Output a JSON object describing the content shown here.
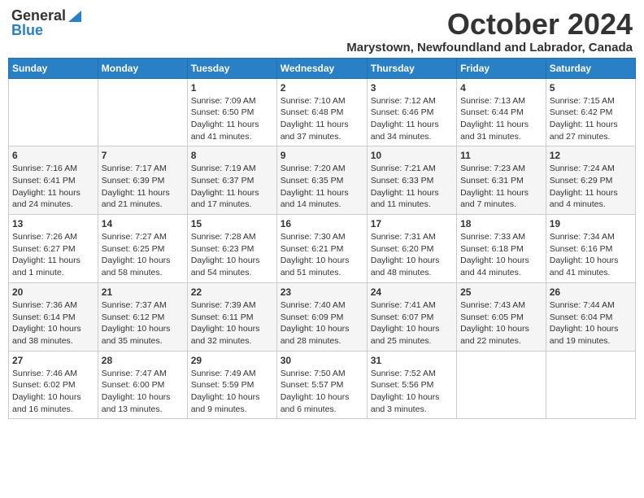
{
  "logo": {
    "general": "General",
    "blue": "Blue"
  },
  "title": "October 2024",
  "location": "Marystown, Newfoundland and Labrador, Canada",
  "days_of_week": [
    "Sunday",
    "Monday",
    "Tuesday",
    "Wednesday",
    "Thursday",
    "Friday",
    "Saturday"
  ],
  "weeks": [
    [
      {
        "day": "",
        "sunrise": "",
        "sunset": "",
        "daylight": ""
      },
      {
        "day": "",
        "sunrise": "",
        "sunset": "",
        "daylight": ""
      },
      {
        "day": "1",
        "sunrise": "Sunrise: 7:09 AM",
        "sunset": "Sunset: 6:50 PM",
        "daylight": "Daylight: 11 hours and 41 minutes."
      },
      {
        "day": "2",
        "sunrise": "Sunrise: 7:10 AM",
        "sunset": "Sunset: 6:48 PM",
        "daylight": "Daylight: 11 hours and 37 minutes."
      },
      {
        "day": "3",
        "sunrise": "Sunrise: 7:12 AM",
        "sunset": "Sunset: 6:46 PM",
        "daylight": "Daylight: 11 hours and 34 minutes."
      },
      {
        "day": "4",
        "sunrise": "Sunrise: 7:13 AM",
        "sunset": "Sunset: 6:44 PM",
        "daylight": "Daylight: 11 hours and 31 minutes."
      },
      {
        "day": "5",
        "sunrise": "Sunrise: 7:15 AM",
        "sunset": "Sunset: 6:42 PM",
        "daylight": "Daylight: 11 hours and 27 minutes."
      }
    ],
    [
      {
        "day": "6",
        "sunrise": "Sunrise: 7:16 AM",
        "sunset": "Sunset: 6:41 PM",
        "daylight": "Daylight: 11 hours and 24 minutes."
      },
      {
        "day": "7",
        "sunrise": "Sunrise: 7:17 AM",
        "sunset": "Sunset: 6:39 PM",
        "daylight": "Daylight: 11 hours and 21 minutes."
      },
      {
        "day": "8",
        "sunrise": "Sunrise: 7:19 AM",
        "sunset": "Sunset: 6:37 PM",
        "daylight": "Daylight: 11 hours and 17 minutes."
      },
      {
        "day": "9",
        "sunrise": "Sunrise: 7:20 AM",
        "sunset": "Sunset: 6:35 PM",
        "daylight": "Daylight: 11 hours and 14 minutes."
      },
      {
        "day": "10",
        "sunrise": "Sunrise: 7:21 AM",
        "sunset": "Sunset: 6:33 PM",
        "daylight": "Daylight: 11 hours and 11 minutes."
      },
      {
        "day": "11",
        "sunrise": "Sunrise: 7:23 AM",
        "sunset": "Sunset: 6:31 PM",
        "daylight": "Daylight: 11 hours and 7 minutes."
      },
      {
        "day": "12",
        "sunrise": "Sunrise: 7:24 AM",
        "sunset": "Sunset: 6:29 PM",
        "daylight": "Daylight: 11 hours and 4 minutes."
      }
    ],
    [
      {
        "day": "13",
        "sunrise": "Sunrise: 7:26 AM",
        "sunset": "Sunset: 6:27 PM",
        "daylight": "Daylight: 11 hours and 1 minute."
      },
      {
        "day": "14",
        "sunrise": "Sunrise: 7:27 AM",
        "sunset": "Sunset: 6:25 PM",
        "daylight": "Daylight: 10 hours and 58 minutes."
      },
      {
        "day": "15",
        "sunrise": "Sunrise: 7:28 AM",
        "sunset": "Sunset: 6:23 PM",
        "daylight": "Daylight: 10 hours and 54 minutes."
      },
      {
        "day": "16",
        "sunrise": "Sunrise: 7:30 AM",
        "sunset": "Sunset: 6:21 PM",
        "daylight": "Daylight: 10 hours and 51 minutes."
      },
      {
        "day": "17",
        "sunrise": "Sunrise: 7:31 AM",
        "sunset": "Sunset: 6:20 PM",
        "daylight": "Daylight: 10 hours and 48 minutes."
      },
      {
        "day": "18",
        "sunrise": "Sunrise: 7:33 AM",
        "sunset": "Sunset: 6:18 PM",
        "daylight": "Daylight: 10 hours and 44 minutes."
      },
      {
        "day": "19",
        "sunrise": "Sunrise: 7:34 AM",
        "sunset": "Sunset: 6:16 PM",
        "daylight": "Daylight: 10 hours and 41 minutes."
      }
    ],
    [
      {
        "day": "20",
        "sunrise": "Sunrise: 7:36 AM",
        "sunset": "Sunset: 6:14 PM",
        "daylight": "Daylight: 10 hours and 38 minutes."
      },
      {
        "day": "21",
        "sunrise": "Sunrise: 7:37 AM",
        "sunset": "Sunset: 6:12 PM",
        "daylight": "Daylight: 10 hours and 35 minutes."
      },
      {
        "day": "22",
        "sunrise": "Sunrise: 7:39 AM",
        "sunset": "Sunset: 6:11 PM",
        "daylight": "Daylight: 10 hours and 32 minutes."
      },
      {
        "day": "23",
        "sunrise": "Sunrise: 7:40 AM",
        "sunset": "Sunset: 6:09 PM",
        "daylight": "Daylight: 10 hours and 28 minutes."
      },
      {
        "day": "24",
        "sunrise": "Sunrise: 7:41 AM",
        "sunset": "Sunset: 6:07 PM",
        "daylight": "Daylight: 10 hours and 25 minutes."
      },
      {
        "day": "25",
        "sunrise": "Sunrise: 7:43 AM",
        "sunset": "Sunset: 6:05 PM",
        "daylight": "Daylight: 10 hours and 22 minutes."
      },
      {
        "day": "26",
        "sunrise": "Sunrise: 7:44 AM",
        "sunset": "Sunset: 6:04 PM",
        "daylight": "Daylight: 10 hours and 19 minutes."
      }
    ],
    [
      {
        "day": "27",
        "sunrise": "Sunrise: 7:46 AM",
        "sunset": "Sunset: 6:02 PM",
        "daylight": "Daylight: 10 hours and 16 minutes."
      },
      {
        "day": "28",
        "sunrise": "Sunrise: 7:47 AM",
        "sunset": "Sunset: 6:00 PM",
        "daylight": "Daylight: 10 hours and 13 minutes."
      },
      {
        "day": "29",
        "sunrise": "Sunrise: 7:49 AM",
        "sunset": "Sunset: 5:59 PM",
        "daylight": "Daylight: 10 hours and 9 minutes."
      },
      {
        "day": "30",
        "sunrise": "Sunrise: 7:50 AM",
        "sunset": "Sunset: 5:57 PM",
        "daylight": "Daylight: 10 hours and 6 minutes."
      },
      {
        "day": "31",
        "sunrise": "Sunrise: 7:52 AM",
        "sunset": "Sunset: 5:56 PM",
        "daylight": "Daylight: 10 hours and 3 minutes."
      },
      {
        "day": "",
        "sunrise": "",
        "sunset": "",
        "daylight": ""
      },
      {
        "day": "",
        "sunrise": "",
        "sunset": "",
        "daylight": ""
      }
    ]
  ]
}
